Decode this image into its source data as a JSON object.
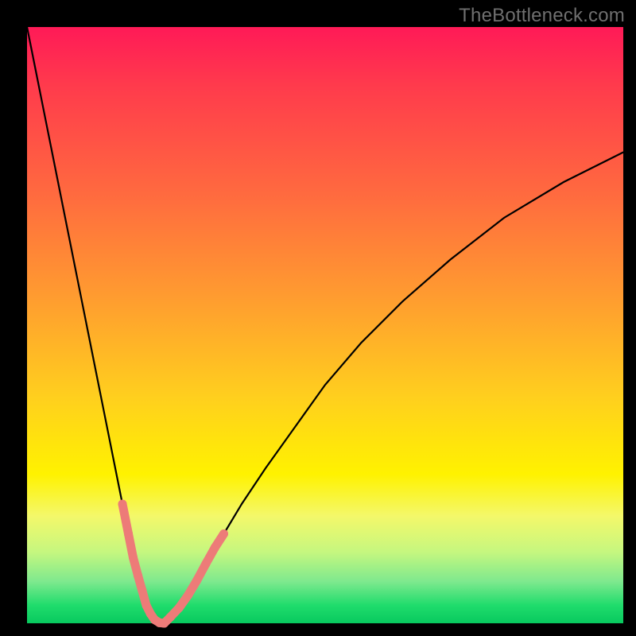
{
  "watermark": "TheBottleneck.com",
  "colors": {
    "marker": "#ed7b78",
    "curve": "#000000",
    "frame": "#000000"
  },
  "chart_data": {
    "type": "line",
    "title": "",
    "xlabel": "",
    "ylabel": "",
    "xlim": [
      0,
      100
    ],
    "ylim": [
      0,
      100
    ],
    "grid": false,
    "legend": false,
    "series": [
      {
        "name": "bottleneck-curve",
        "x": [
          0,
          2,
          4,
          6,
          8,
          10,
          12,
          14,
          16,
          18,
          19,
          20,
          21,
          22,
          23,
          24,
          26,
          28,
          30,
          33,
          36,
          40,
          45,
          50,
          56,
          63,
          71,
          80,
          90,
          100
        ],
        "values": [
          100,
          90,
          80,
          70,
          60,
          50,
          40,
          30,
          20,
          10,
          6,
          3,
          1,
          0,
          0,
          1,
          3,
          6,
          10,
          15,
          20,
          26,
          33,
          40,
          47,
          54,
          61,
          68,
          74,
          79
        ]
      }
    ],
    "markers": {
      "name": "highlighted-points",
      "x": [
        16.0,
        17.0,
        17.8,
        18.6,
        19.3,
        20.0,
        20.7,
        21.4,
        22.2,
        23.0,
        24.0,
        25.5,
        27.0,
        28.5,
        30.0,
        31.5,
        33.0
      ],
      "values": [
        20.0,
        15.0,
        11.0,
        8.0,
        5.5,
        3.0,
        1.6,
        0.6,
        0.1,
        0.0,
        1.0,
        2.6,
        4.7,
        7.2,
        10.0,
        12.7,
        15.0
      ]
    }
  }
}
